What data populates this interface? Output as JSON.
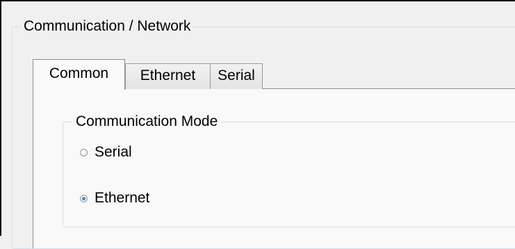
{
  "group": {
    "title": "Communication / Network"
  },
  "tabs": [
    {
      "label": "Common",
      "active": true
    },
    {
      "label": "Ethernet",
      "active": false
    },
    {
      "label": "Serial",
      "active": false
    }
  ],
  "communication_mode": {
    "title": "Communication Mode",
    "options": [
      {
        "label": "Serial",
        "checked": false
      },
      {
        "label": "Ethernet",
        "checked": true
      }
    ]
  }
}
